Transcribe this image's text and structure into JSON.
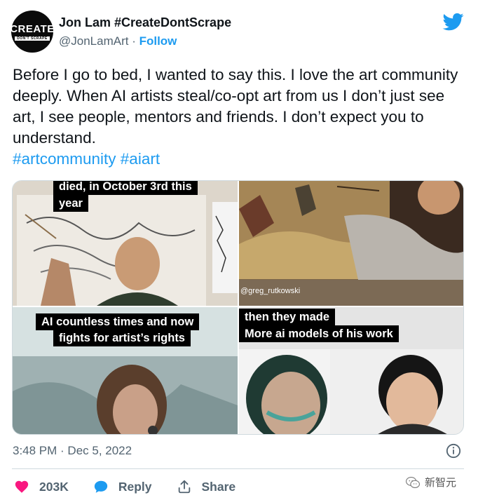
{
  "author": {
    "avatar_text": "CREATE",
    "avatar_subtext": "DON'T SCRAPE",
    "display_name": "Jon Lam #CreateDontScrape",
    "handle": "@JonLamArt",
    "separator": " · ",
    "follow_label": "Follow"
  },
  "tweet": {
    "text": "Before I go to bed, I wanted to say this. I love the art community deeply. When AI artists steal/co-opt art from us I don’t just see art, I see people, mentors and friends. I don’t expect you to understand.",
    "hashtags": "#artcommunity #aiart"
  },
  "media": {
    "image1": {
      "caption_line1": "died, in October 3rd this",
      "caption_line2": "year"
    },
    "image2": {
      "handle_overlay": "@greg_rutkowski"
    },
    "image3": {
      "caption_line1": "AI countless times and now",
      "caption_line2": "fights for artist’s rights"
    },
    "image4": {
      "caption_line1": "then they made",
      "caption_line2": "More ai models of his work"
    }
  },
  "meta": {
    "timestamp": "3:48 PM · Dec 5, 2022"
  },
  "actions": {
    "like_count": "203K",
    "reply_label": "Reply",
    "share_label": "Share"
  },
  "watermark": {
    "text": "新智元"
  },
  "colors": {
    "accent": "#1d9bf0",
    "like": "#f91880",
    "muted": "#536471"
  }
}
